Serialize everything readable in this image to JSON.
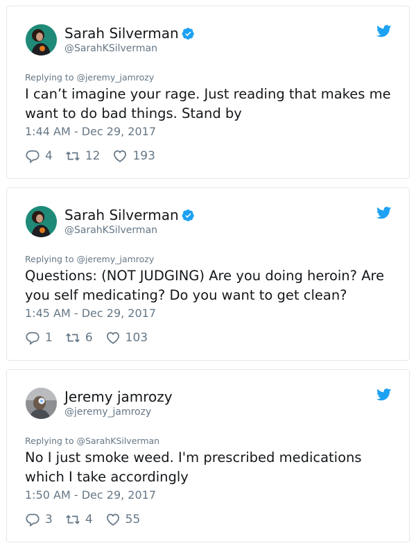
{
  "colors": {
    "twitter_blue": "#1da1f2",
    "text": "#14171a",
    "muted": "#657786",
    "border": "#e1e8ed"
  },
  "icons": {
    "reply": "reply-icon",
    "retweet": "retweet-icon",
    "like": "heart-icon",
    "verified": "verified-badge-icon",
    "logo": "twitter-bird-icon"
  },
  "tweets": [
    {
      "name": "Sarah Silverman",
      "handle": "@SarahKSilverman",
      "verified": true,
      "replying_to": "Replying to @jeremy_jamrozy",
      "text": "I can’t imagine your rage. Just reading that makes me want to do bad things. Stand by",
      "time": "1:44 AM - Dec 29, 2017",
      "replies": "4",
      "retweets": "12",
      "likes": "193"
    },
    {
      "name": "Sarah Silverman",
      "handle": "@SarahKSilverman",
      "verified": true,
      "replying_to": "Replying to @jeremy_jamrozy",
      "text": "Questions: (NOT JUDGING) Are you doing heroin? Are you self medicating? Do you want to get clean?",
      "time": "1:45 AM - Dec 29, 2017",
      "replies": "1",
      "retweets": "6",
      "likes": "103"
    },
    {
      "name": "Jeremy jamrozy",
      "handle": "@jeremy_jamrozy",
      "verified": false,
      "replying_to": "Replying to @SarahKSilverman",
      "text": "No I just smoke weed. I'm prescribed medications which I take accordingly",
      "time": "1:50 AM - Dec 29, 2017",
      "replies": "3",
      "retweets": "4",
      "likes": "55"
    }
  ]
}
